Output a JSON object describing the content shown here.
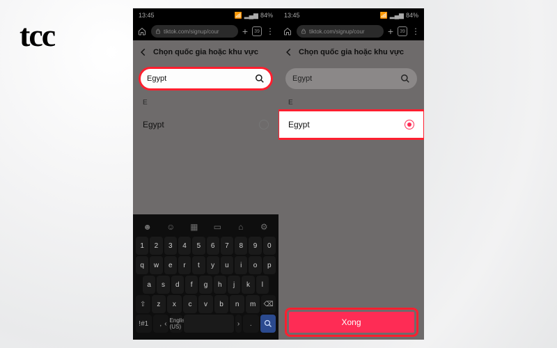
{
  "logo": "tcc",
  "statusbar": {
    "time": "13:45",
    "battery": "84%",
    "signal_icons": [
      "wifi-off",
      "vibrate",
      "signal",
      "signal",
      "battery"
    ]
  },
  "browser": {
    "url": "tiktok.com/signup/cour",
    "tab_count": "39"
  },
  "header": {
    "title": "Chọn quốc gia hoặc khu vực"
  },
  "search": {
    "value": "Egypt",
    "placeholder": "Egypt"
  },
  "list": {
    "section": "E",
    "item": "Egypt"
  },
  "keyboard": {
    "row1": [
      "1",
      "2",
      "3",
      "4",
      "5",
      "6",
      "7",
      "8",
      "9",
      "0"
    ],
    "row2": [
      "q",
      "w",
      "e",
      "r",
      "t",
      "y",
      "u",
      "i",
      "o",
      "p"
    ],
    "row3": [
      "a",
      "s",
      "d",
      "f",
      "g",
      "h",
      "j",
      "k",
      "l"
    ],
    "row4_shift": "⇧",
    "row4": [
      "z",
      "x",
      "c",
      "v",
      "b",
      "n",
      "m"
    ],
    "row4_bksp": "⌫",
    "row5_sym": "!#1",
    "row5_comma": ",",
    "row5_lang": "English (US)",
    "row5_dot": ".",
    "row5_enter": "🔍"
  },
  "done": {
    "label": "Xong"
  }
}
